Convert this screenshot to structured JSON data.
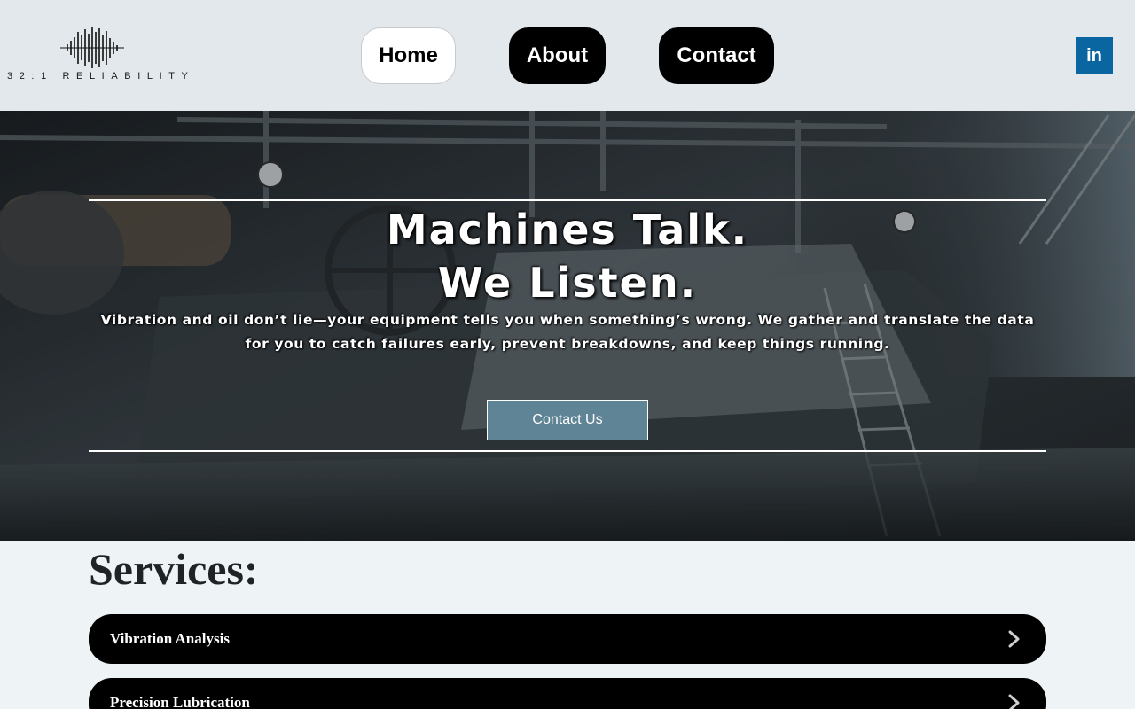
{
  "brand": {
    "logo_text": "32:1 RELIABILITY",
    "logo_icon": "sound-wave-icon"
  },
  "nav": {
    "items": [
      {
        "label": "Home",
        "active": true
      },
      {
        "label": "About",
        "active": false
      },
      {
        "label": "Contact",
        "active": false
      }
    ],
    "social": {
      "label": "in",
      "icon": "linkedin-icon",
      "color": "#0a66a0"
    }
  },
  "hero": {
    "title_line1": "Machines Talk.",
    "title_line2": "We Listen.",
    "subtitle": "Vibration and oil don’t lie—your equipment tells you when something’s wrong. We gather and translate the data for you to catch failures early, prevent breakdowns, and keep things running.",
    "cta_label": "Contact Us",
    "cta_color": "#5e8496"
  },
  "services": {
    "title": "Services:",
    "items": [
      {
        "label": "Vibration Analysis",
        "icon": "chevron-right-icon"
      },
      {
        "label": "Precision Lubrication",
        "icon": "chevron-right-icon"
      }
    ]
  }
}
